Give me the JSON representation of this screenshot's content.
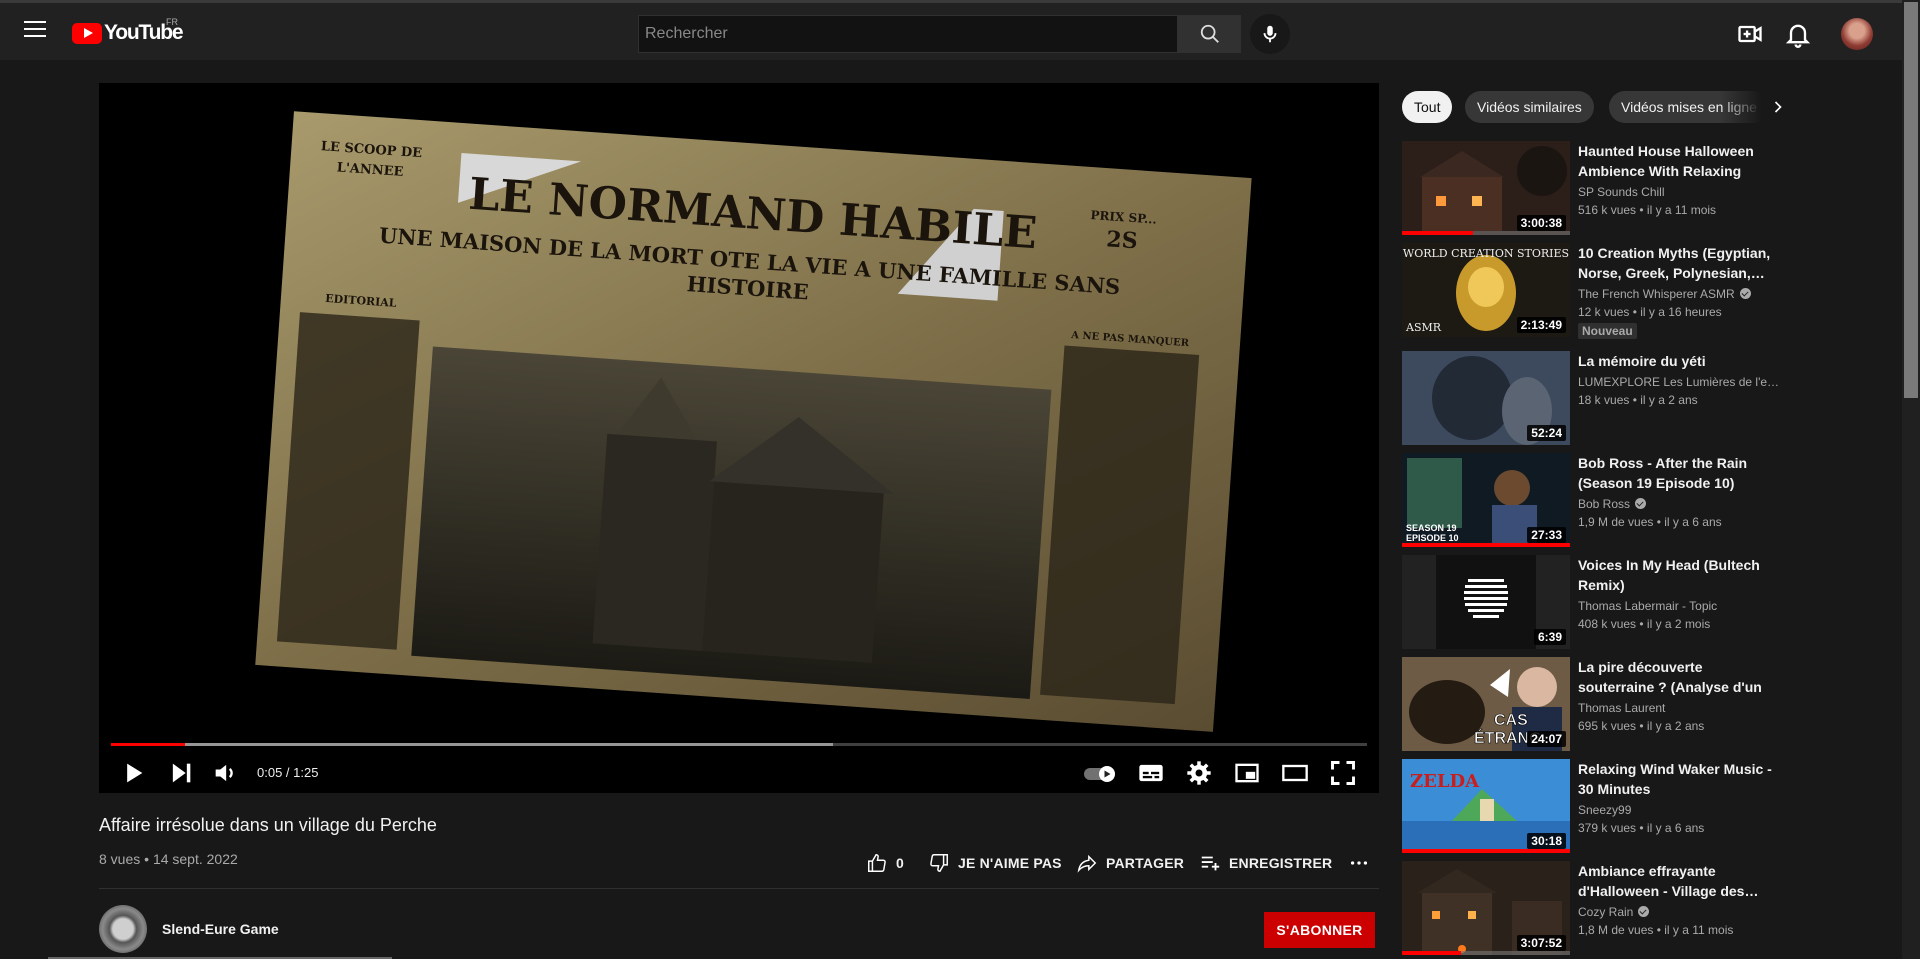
{
  "header": {
    "logo_text": "YouTube",
    "country_code": "FR",
    "search_placeholder": "Rechercher",
    "icons": [
      "menu-icon",
      "search-icon",
      "mic-icon",
      "create-video-icon",
      "notifications-bell-icon"
    ]
  },
  "player": {
    "time_current": "0:05",
    "time_separator": " / ",
    "time_total": "1:25",
    "progress_played_fraction": 0.059,
    "progress_loaded_fraction": 0.575,
    "newspaper": {
      "masthead": "LE NORMAND HABILE",
      "headline_line1": "UNE MAISON DE LA MORT OTE LA VIE A UNE FAMILLE SANS",
      "headline_line2": "HISTOIRE",
      "corner_left_1": "LE SCOOP DE",
      "corner_left_2": "L'ANNEE",
      "corner_right_1": "PRIX SP...",
      "corner_right_2": "2S",
      "col_left_label": "EDITORIAL",
      "col_right_label": "A NE PAS MANQUER"
    }
  },
  "video": {
    "title": "Affaire irrésolue dans un village du Perche",
    "views": "8 vues",
    "separator": " • ",
    "date": "14 sept. 2022",
    "like_count": "0",
    "dislike_label": "JE N'AIME PAS",
    "share_label": "PARTAGER",
    "save_label": "ENREGISTRER"
  },
  "channel": {
    "name": "Slend-Eure Game",
    "subscribe_label": "S'ABONNER"
  },
  "chips": [
    "Tout",
    "Vidéos similaires",
    "Vidéos mises en ligne"
  ],
  "recommended": [
    {
      "title": "Haunted House Halloween Ambience With Relaxing Spoo…",
      "channel": "SP Sounds Chill",
      "verified": false,
      "views": "516 k vues",
      "age": "il y a 11 mois",
      "duration": "3:00:38",
      "watched": 0.42,
      "badge": ""
    },
    {
      "title": "10 Creation Myths (Egyptian, Norse, Greek, Polynesian,…",
      "channel": "The French Whisperer ASMR",
      "verified": true,
      "views": "12 k vues",
      "age": "il y a 16 heures",
      "duration": "2:13:49",
      "watched": 0,
      "badge": "Nouveau",
      "thumb_text_1": "WORLD CREATION STORIES",
      "thumb_text_2": "ASMR"
    },
    {
      "title": "La mémoire du yéti",
      "channel": "LUMEXPLORE Les Lumières de l'exp…",
      "verified": false,
      "views": "18 k vues",
      "age": "il y a 2 ans",
      "duration": "52:24",
      "watched": 0,
      "badge": ""
    },
    {
      "title": "Bob Ross - After the Rain (Season 19 Episode 10)",
      "channel": "Bob Ross",
      "verified": true,
      "views": "1,9 M de vues",
      "age": "il y a 6 ans",
      "duration": "27:33",
      "watched": 1,
      "badge": "",
      "thumb_text_1": "SEASON 19",
      "thumb_text_2": "EPISODE 10"
    },
    {
      "title": "Voices In My Head (Bultech Remix)",
      "channel": "Thomas Labermair - Topic",
      "verified": false,
      "views": "408 k vues",
      "age": "il y a 2 mois",
      "duration": "6:39",
      "watched": 0,
      "badge": ""
    },
    {
      "title": "La pire découverte souterraine ? (Analyse d'un cas non publié)",
      "channel": "Thomas Laurent",
      "verified": false,
      "views": "695 k vues",
      "age": "il y a 2 ans",
      "duration": "24:07",
      "watched": 0,
      "badge": "",
      "thumb_text_1": "CAS",
      "thumb_text_2": "ÉTRANG"
    },
    {
      "title": "Relaxing Wind Waker Music - 30 Minutes",
      "channel": "Sneezy99",
      "verified": false,
      "views": "379 k vues",
      "age": "il y a 6 ans",
      "duration": "30:18",
      "watched": 1,
      "badge": "",
      "thumb_text_1": "ZELDA"
    },
    {
      "title": "Ambiance effrayante d'Halloween - Village des…",
      "channel": "Cozy Rain",
      "verified": true,
      "views": "1,8 M de vues",
      "age": "il y a 11 mois",
      "duration": "3:07:52",
      "watched": 0.35,
      "badge": ""
    }
  ],
  "colors": {
    "background": "#181818",
    "masthead": "#212121",
    "accent_red": "#ff0000",
    "subscribe_red": "#cc0000",
    "text_primary": "#f1f1f1",
    "text_secondary": "#aaaaaa"
  }
}
